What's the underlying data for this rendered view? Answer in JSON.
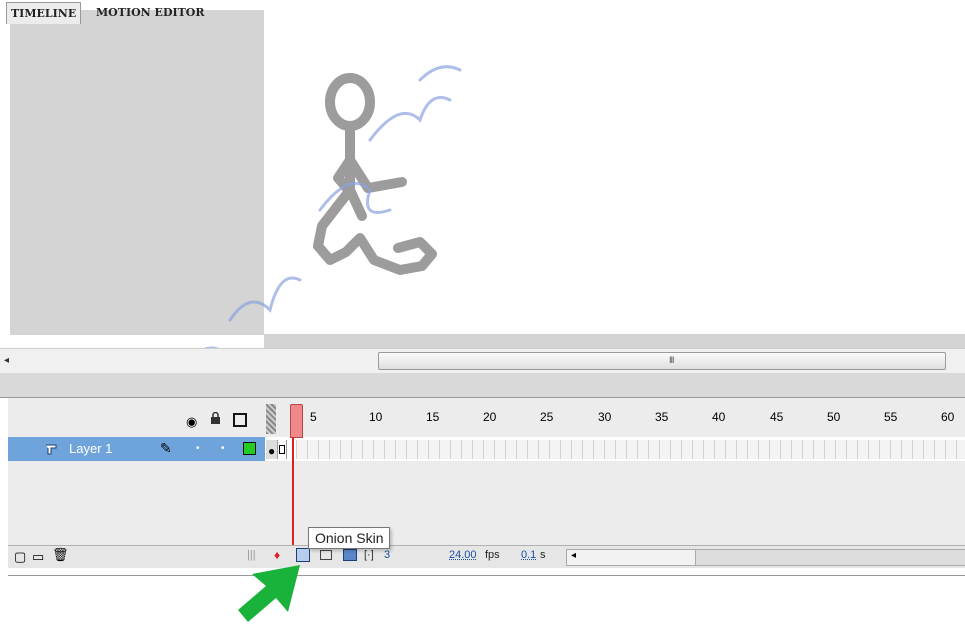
{
  "scrollbar": {
    "left_arrow": "◂",
    "grip": "III"
  },
  "tabs": [
    {
      "label": "TIMELINE"
    },
    {
      "label": "MOTION EDITOR"
    }
  ],
  "ruler": {
    "ticks": [
      "5",
      "10",
      "15",
      "20",
      "25",
      "30",
      "35",
      "40",
      "45",
      "50",
      "55",
      "60"
    ]
  },
  "layer": {
    "name": "Layer 1"
  },
  "status": {
    "frame": "3",
    "fps": "24.00",
    "fps_unit": "fps",
    "time": "0.1",
    "time_unit": "s"
  },
  "tooltip": {
    "text": "Onion Skin"
  },
  "colors": {
    "layer_selected": "#6fa3dc",
    "playhead": "#e02020",
    "arrow": "#19b23a",
    "outline_swatch": "#22cc22"
  },
  "icons": [
    "eye-icon",
    "lock-icon",
    "outline-icon",
    "layer-icon",
    "pencil-icon",
    "new-layer-icon",
    "new-folder-icon",
    "trash-icon",
    "onion-skin-icon",
    "onion-outline-icon",
    "edit-multiple-icon",
    "modify-markers-icon",
    "green-arrow-icon"
  ]
}
